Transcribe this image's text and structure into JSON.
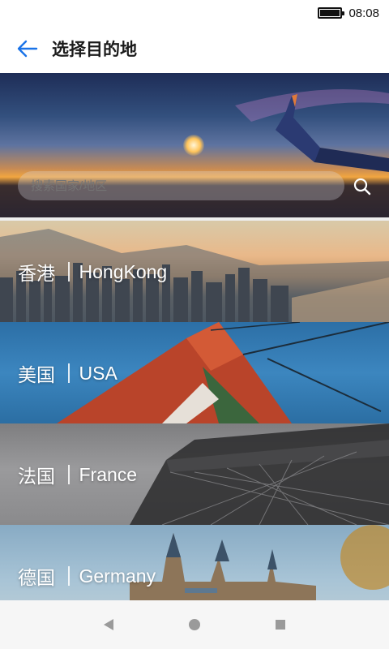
{
  "status_bar": {
    "time": "08:08",
    "battery_icon": "battery-full-icon"
  },
  "app_bar": {
    "title": "选择目的地",
    "back_icon": "back-arrow-icon",
    "accent_color": "#1a73e8"
  },
  "hero": {
    "search": {
      "placeholder": "搜索国家/地区",
      "value": ""
    },
    "search_icon": "search-icon"
  },
  "destinations": [
    {
      "cn": "香港",
      "en": "HongKong"
    },
    {
      "cn": "美国",
      "en": "USA"
    },
    {
      "cn": "法国",
      "en": "France"
    },
    {
      "cn": "德国",
      "en": "Germany"
    }
  ],
  "nav_bar": {
    "back": "nav-back-icon",
    "home": "nav-home-icon",
    "recents": "nav-recents-icon"
  }
}
